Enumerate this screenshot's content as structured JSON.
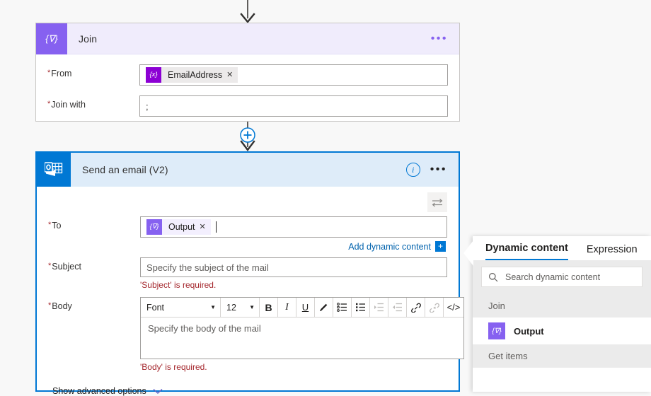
{
  "join_card": {
    "icon_glyph": "{∇}",
    "icon_name": "join-action-icon",
    "title": "Join",
    "more_label": "•••",
    "fields": [
      {
        "label": "From",
        "required": true,
        "token": {
          "icon_glyph": "{x}",
          "label": "EmailAddress",
          "remove": "✕"
        }
      },
      {
        "label": "Join with",
        "required": true,
        "value": ";"
      }
    ]
  },
  "email_card": {
    "icon_name": "outlook-icon",
    "title": "Send an email (V2)",
    "info_label": "i",
    "more_label": "•••",
    "swap_label": "switch-input-mode",
    "to": {
      "label": "To",
      "required": true,
      "token": {
        "icon_glyph": "{∇}",
        "label": "Output",
        "remove": "✕"
      }
    },
    "add_dynamic_content": {
      "text": "Add dynamic content",
      "plus": "+"
    },
    "subject": {
      "label": "Subject",
      "required": true,
      "placeholder": "Specify the subject of the mail",
      "error": "'Subject' is required."
    },
    "body": {
      "label": "Body",
      "required": true,
      "placeholder": "Specify the body of the mail",
      "error": "'Body' is required.",
      "toolbar": {
        "font_label": "Font",
        "size_label": "12",
        "bold": "B",
        "italic": "I",
        "underline": "U",
        "text_color": "pen-icon",
        "bulleted_list": "bulleted-list-icon",
        "numbered_list": "numbered-list-icon",
        "indent": "indent-icon",
        "outdent": "outdent-icon",
        "link": "link-icon",
        "unlink": "unlink-icon",
        "code_view": "</>"
      }
    },
    "advanced": {
      "label": "Show advanced options",
      "chevron": "chevron-down-icon"
    }
  },
  "dynamic_panel": {
    "tabs": [
      {
        "label": "Dynamic content",
        "active": true
      },
      {
        "label": "Expression",
        "active": false
      }
    ],
    "search_placeholder": "Search dynamic content",
    "groups": [
      {
        "name": "Join",
        "items": [
          {
            "icon_glyph": "{∇}",
            "label": "Output"
          }
        ]
      },
      {
        "name": "Get items",
        "items": []
      }
    ]
  },
  "colors": {
    "join_purple": "#8661f0",
    "expression_purple": "#8c00d4",
    "outlook_blue": "#0078d4",
    "error_red": "#a4262c",
    "link_blue": "#0062ad",
    "canvas": "#f8f8f8"
  }
}
